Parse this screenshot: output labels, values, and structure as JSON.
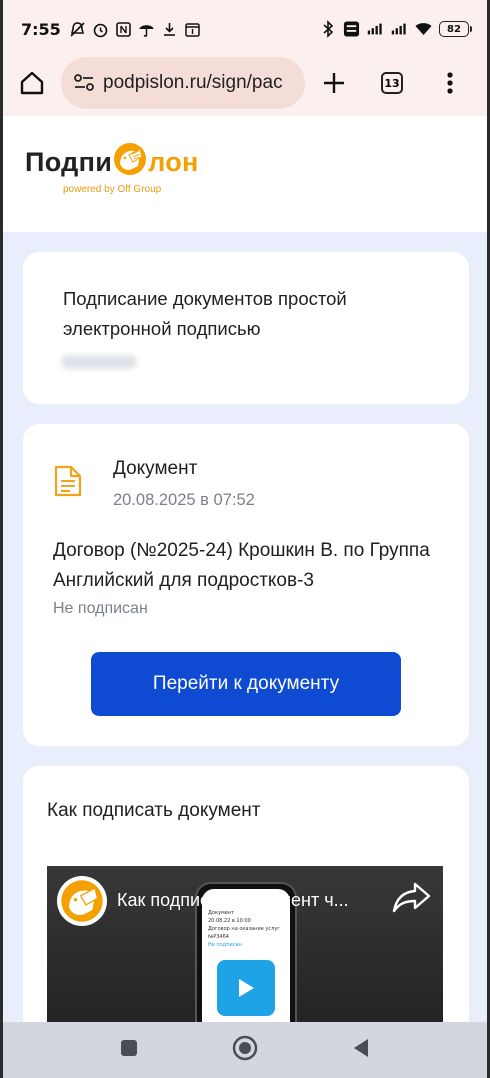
{
  "status_bar": {
    "time": "7:55",
    "battery": "82"
  },
  "browser": {
    "url": "podpislon.ru/sign/pac",
    "tab_count": "13"
  },
  "site": {
    "logo_part1": "Подпи",
    "logo_part2": "лон",
    "logo_subtitle": "powered by Off Group"
  },
  "card_signing": {
    "title": "Подписание документов простой электронной подписью"
  },
  "document": {
    "kind": "Документ",
    "date": "20.08.2025 в 07:52",
    "name": "Договор (№2025-24) Крошкин В. по Группа Английский для подростков-3",
    "status": "Не подписан",
    "button_label": "Перейти к документу"
  },
  "howto": {
    "heading": "Как подписать документ",
    "video_title": "Как подписать документ ч...",
    "screen_line1": "Документ",
    "screen_line2": "20.08.22 в 10:00",
    "screen_line3": "Договор на оказание услуг",
    "screen_line4": "№Р3464",
    "screen_line5": "Не подписан"
  },
  "colors": {
    "accent": "#0e4bd2",
    "brand_orange": "#f4a000",
    "page_bg": "#e8eefb"
  }
}
